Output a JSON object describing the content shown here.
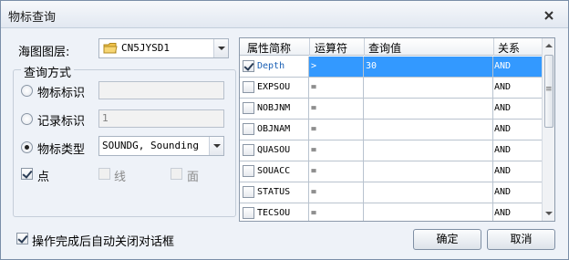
{
  "window": {
    "title": "物标查询"
  },
  "chart_layer": {
    "label": "海图图层:",
    "value": "CN5JYSD1"
  },
  "query_mode": {
    "title": "查询方式",
    "object_id": {
      "label": "物标标识",
      "value": ""
    },
    "record_id": {
      "label": "记录标识",
      "value": "1"
    },
    "object_class": {
      "label": "物标类型",
      "value": "SOUNDG, Sounding"
    },
    "geometry": {
      "point": "点",
      "line": "线",
      "area": "面"
    }
  },
  "attribute_table": {
    "columns": [
      "属性简称",
      "运算符",
      "查询值",
      "关系"
    ],
    "rows": [
      {
        "name": "Depth",
        "op": ">",
        "value": "30",
        "rel": "AND",
        "checked": true,
        "selected": true
      },
      {
        "name": "EXPSOU",
        "op": "=",
        "value": "",
        "rel": "AND",
        "checked": false,
        "selected": false
      },
      {
        "name": "NOBJNM",
        "op": "=",
        "value": "",
        "rel": "AND",
        "checked": false,
        "selected": false
      },
      {
        "name": "OBJNAM",
        "op": "=",
        "value": "",
        "rel": "AND",
        "checked": false,
        "selected": false
      },
      {
        "name": "QUASOU",
        "op": "=",
        "value": "",
        "rel": "AND",
        "checked": false,
        "selected": false
      },
      {
        "name": "SOUACC",
        "op": "=",
        "value": "",
        "rel": "AND",
        "checked": false,
        "selected": false
      },
      {
        "name": "STATUS",
        "op": "=",
        "value": "",
        "rel": "AND",
        "checked": false,
        "selected": false
      },
      {
        "name": "TECSOU",
        "op": "=",
        "value": "",
        "rel": "AND",
        "checked": false,
        "selected": false
      }
    ]
  },
  "auto_close": {
    "label": "操作完成后自动关闭对话框"
  },
  "buttons": {
    "ok": "确定",
    "cancel": "取消"
  }
}
